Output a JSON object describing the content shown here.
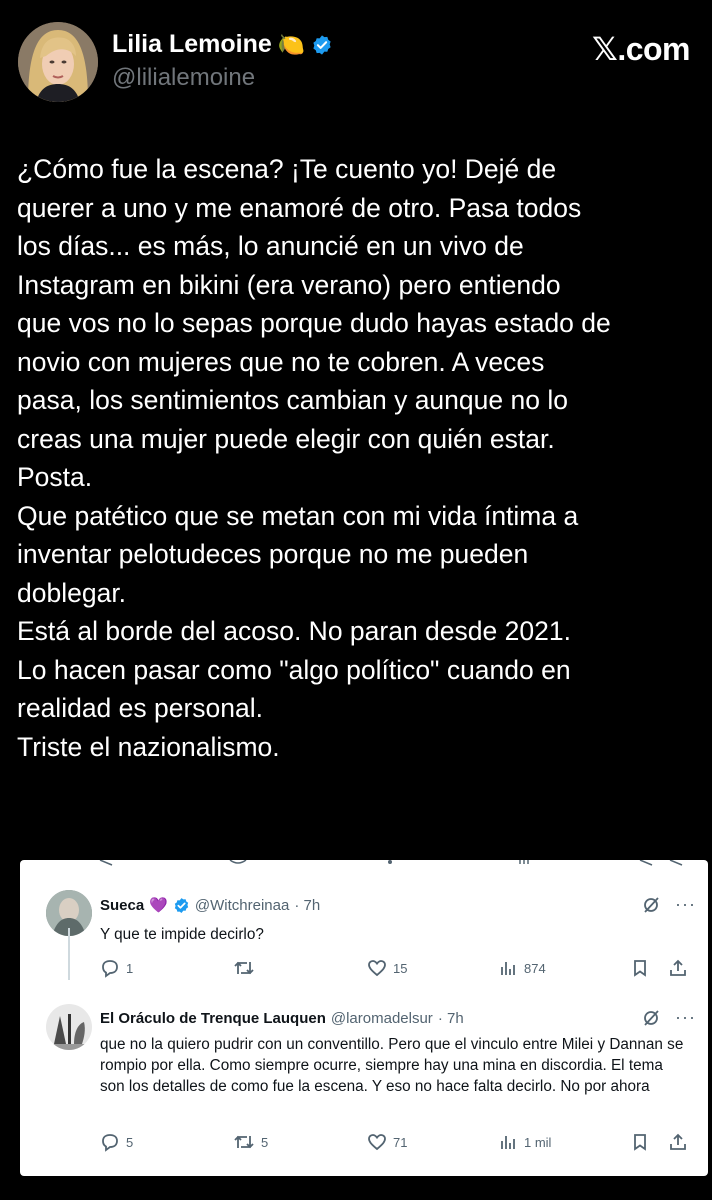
{
  "header": {
    "author_name": "Lilia Lemoine",
    "author_emoji": "🍋",
    "handle": "@lilialemoine",
    "brand_x": "𝕏",
    "brand_suffix": ".com"
  },
  "tweet": {
    "text": "¿Cómo fue la escena? ¡Te cuento yo! Dejé de\nquerer a uno y me enamoré de otro. Pasa todos\nlos días... es más, lo anuncié en un vivo de\nInstagram en bikini (era verano) pero entiendo\nque vos no lo sepas porque dudo hayas estado de\nnovio con mujeres que no te cobren. A veces\npasa, los sentimientos cambian y aunque no lo\ncreas una mujer puede elegir con quién estar.\nPosta.\nQue patético que se metan con mi vida íntima a\ninventar pelotudeces porque no me pueden\ndoblegar.\nEstá al borde del acoso. No paran desde 2021.\nLo hacen pasar como \"algo político\" cuando en\nrealidad es personal.\nTriste el nazionalismo."
  },
  "screenshot": {
    "reply1": {
      "name": "Sueca",
      "emoji": "💜",
      "handle": "@Witchreinaa",
      "time": "· 7h",
      "text": "Y que te impide decirlo?",
      "replies": "1",
      "retweets": "",
      "likes": "15",
      "views": "874"
    },
    "reply2": {
      "name": "El Oráculo de Trenque Lauquen",
      "handle": "@laromadelsur",
      "time": "· 7h",
      "text": "que no la quiero pudrir con un conventillo. Pero que el vinculo entre Milei y Dannan se rompio por ella. Como siempre ocurre, siempre hay una mina en discordia. El tema son los detalles de como fue la escena. Y eso no hace falta decirlo. No por ahora",
      "replies": "5",
      "retweets": "5",
      "likes": "71",
      "views": "1 mil"
    }
  },
  "colors": {
    "background": "#000000",
    "text": "#ffffff",
    "muted": "#71767b",
    "verified": "#1d9bf0",
    "card_bg": "#ffffff",
    "card_muted": "#536471"
  }
}
